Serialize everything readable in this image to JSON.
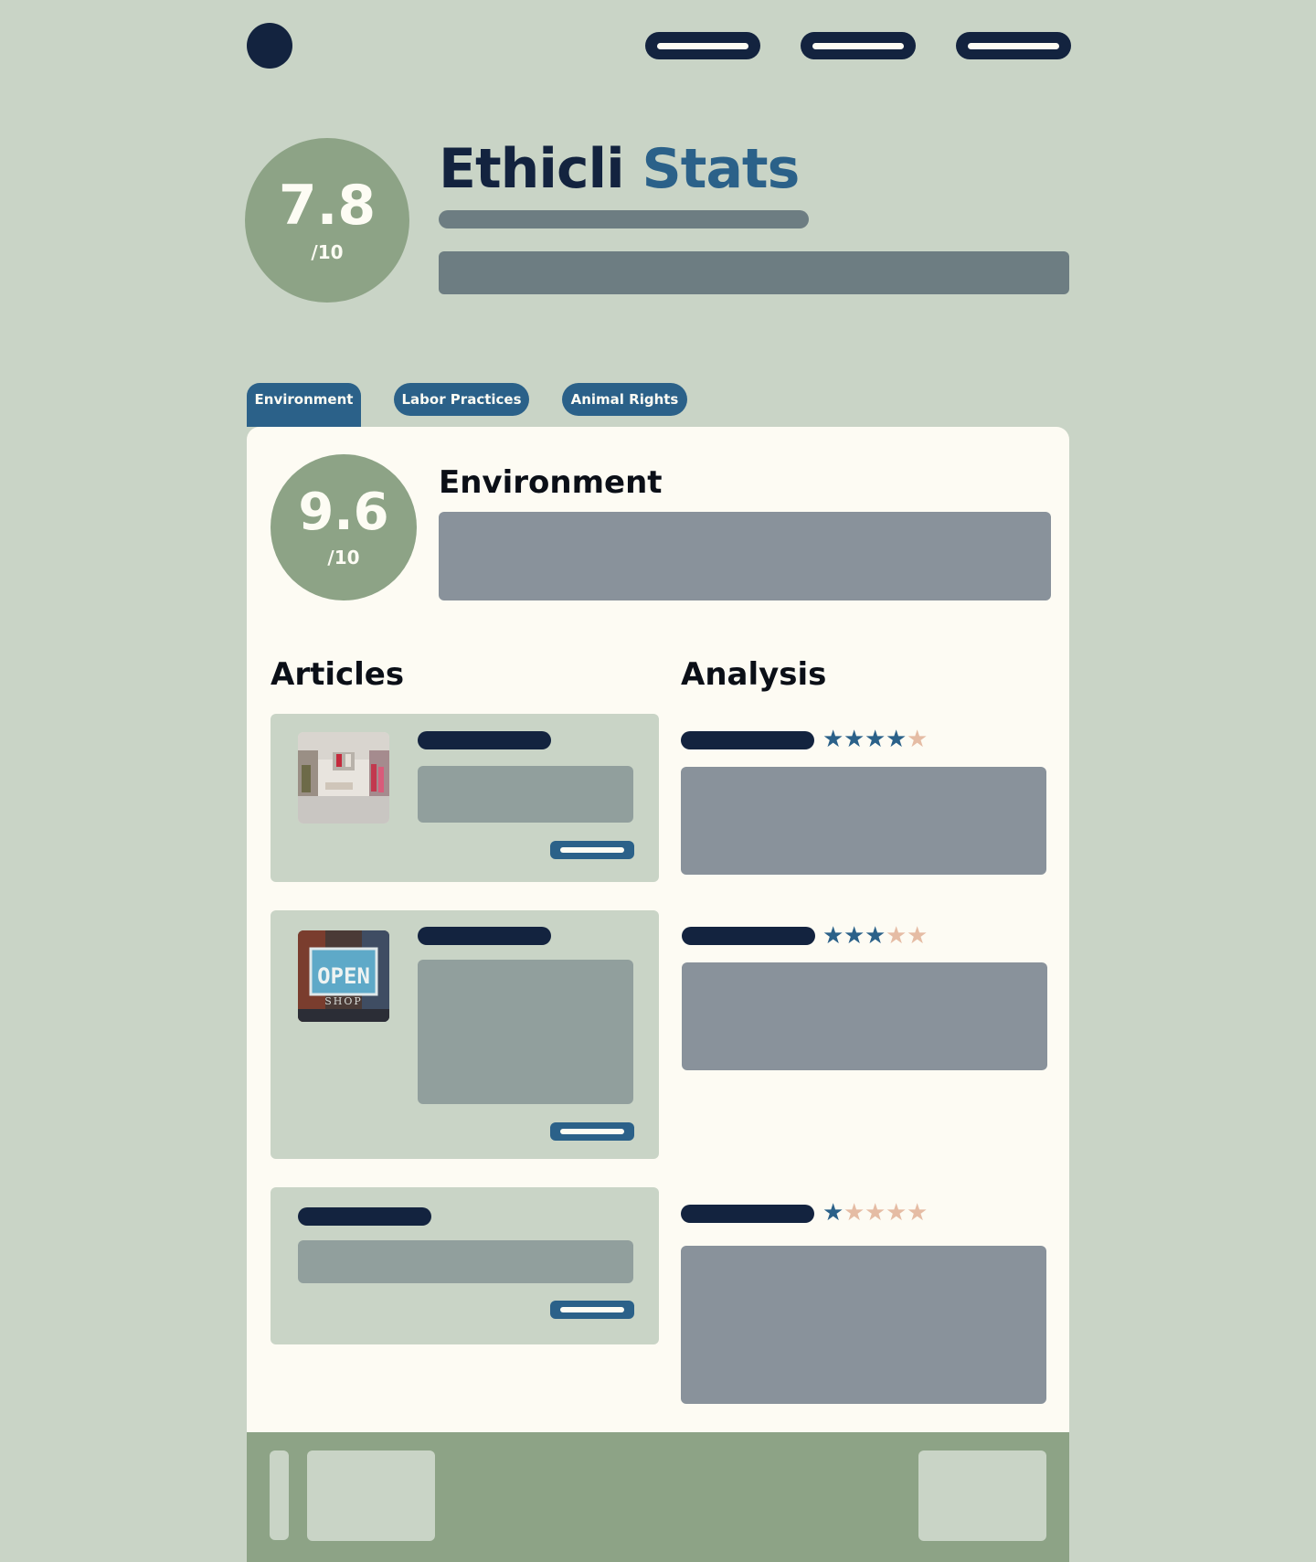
{
  "header": {
    "nav_items": [
      "nav-link-1",
      "nav-link-2",
      "nav-link-3"
    ]
  },
  "brand": {
    "title_part1": "Ethicli",
    "title_part2": "Stats",
    "overall_score": "7.8",
    "overall_denominator": "/10"
  },
  "tabs": [
    {
      "label": "Environment",
      "active": true
    },
    {
      "label": "Labor Practices",
      "active": false
    },
    {
      "label": "Animal Rights",
      "active": false
    }
  ],
  "section": {
    "title": "Environment",
    "score": "9.6",
    "denominator": "/10"
  },
  "articles": {
    "heading": "Articles",
    "items": [
      {
        "thumbnail": "clothing-store-interior-image"
      },
      {
        "thumbnail": "open-shop-sign-image"
      },
      {
        "thumbnail": null
      }
    ]
  },
  "analysis": {
    "heading": "Analysis",
    "items": [
      {
        "rating": 4,
        "max": 5
      },
      {
        "rating": 3,
        "max": 5
      },
      {
        "rating": 1,
        "max": 5
      }
    ]
  },
  "colors": {
    "background": "#c9d4c6",
    "navy": "#13233f",
    "accent_blue": "#2b6189",
    "sage": "#8da386",
    "panel": "#fdfbf3",
    "star_off": "#e5bca4"
  }
}
